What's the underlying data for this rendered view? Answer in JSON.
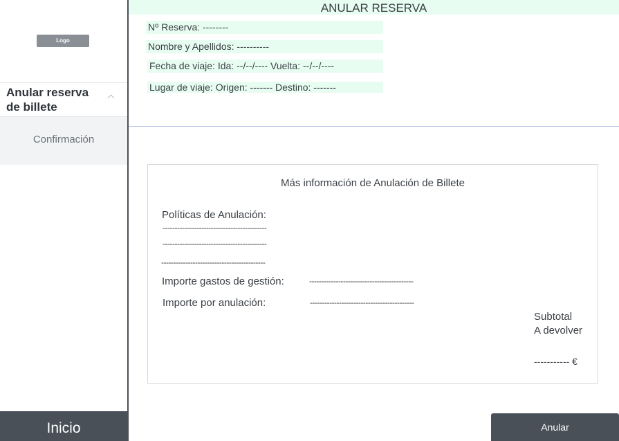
{
  "sidebar": {
    "logo": "Logo",
    "nav_group": "Anular reserva de billete",
    "nav_sub": "Confirmación",
    "inicio": "Inicio"
  },
  "header": {
    "title": "ANULAR RESERVA",
    "reserva": "Nº Reserva: --------",
    "nombre": "Nombre y Apellidos: ----------",
    "fecha": "Fecha de viaje: Ida: --/--/---- Vuelta: --/--/----",
    "lugar": "Lugar de viaje: Origen: -------  Destino: -------"
  },
  "card": {
    "title": "Más información de Anulación de Billete",
    "policies_label": "Políticas de Anulación:",
    "policy_lines": [
      "-------------------------------------------",
      "-------------------------------------------",
      "-------------------------------------------"
    ],
    "gastos_label": "Importe gastos de gestión:",
    "gastos_value": "-------------------------------------------",
    "anulacion_label": "Importe por anulación:",
    "anulacion_value": "-------------------------------------------",
    "subtotal_label": "Subtotal",
    "devolver_label": "A devolver",
    "amount": "----------- €"
  },
  "actions": {
    "anular": "Anular"
  },
  "colors": {
    "accent_green": "#e8fdf1",
    "dark_button": "#4a5058",
    "divider": "#b9c0e6"
  }
}
